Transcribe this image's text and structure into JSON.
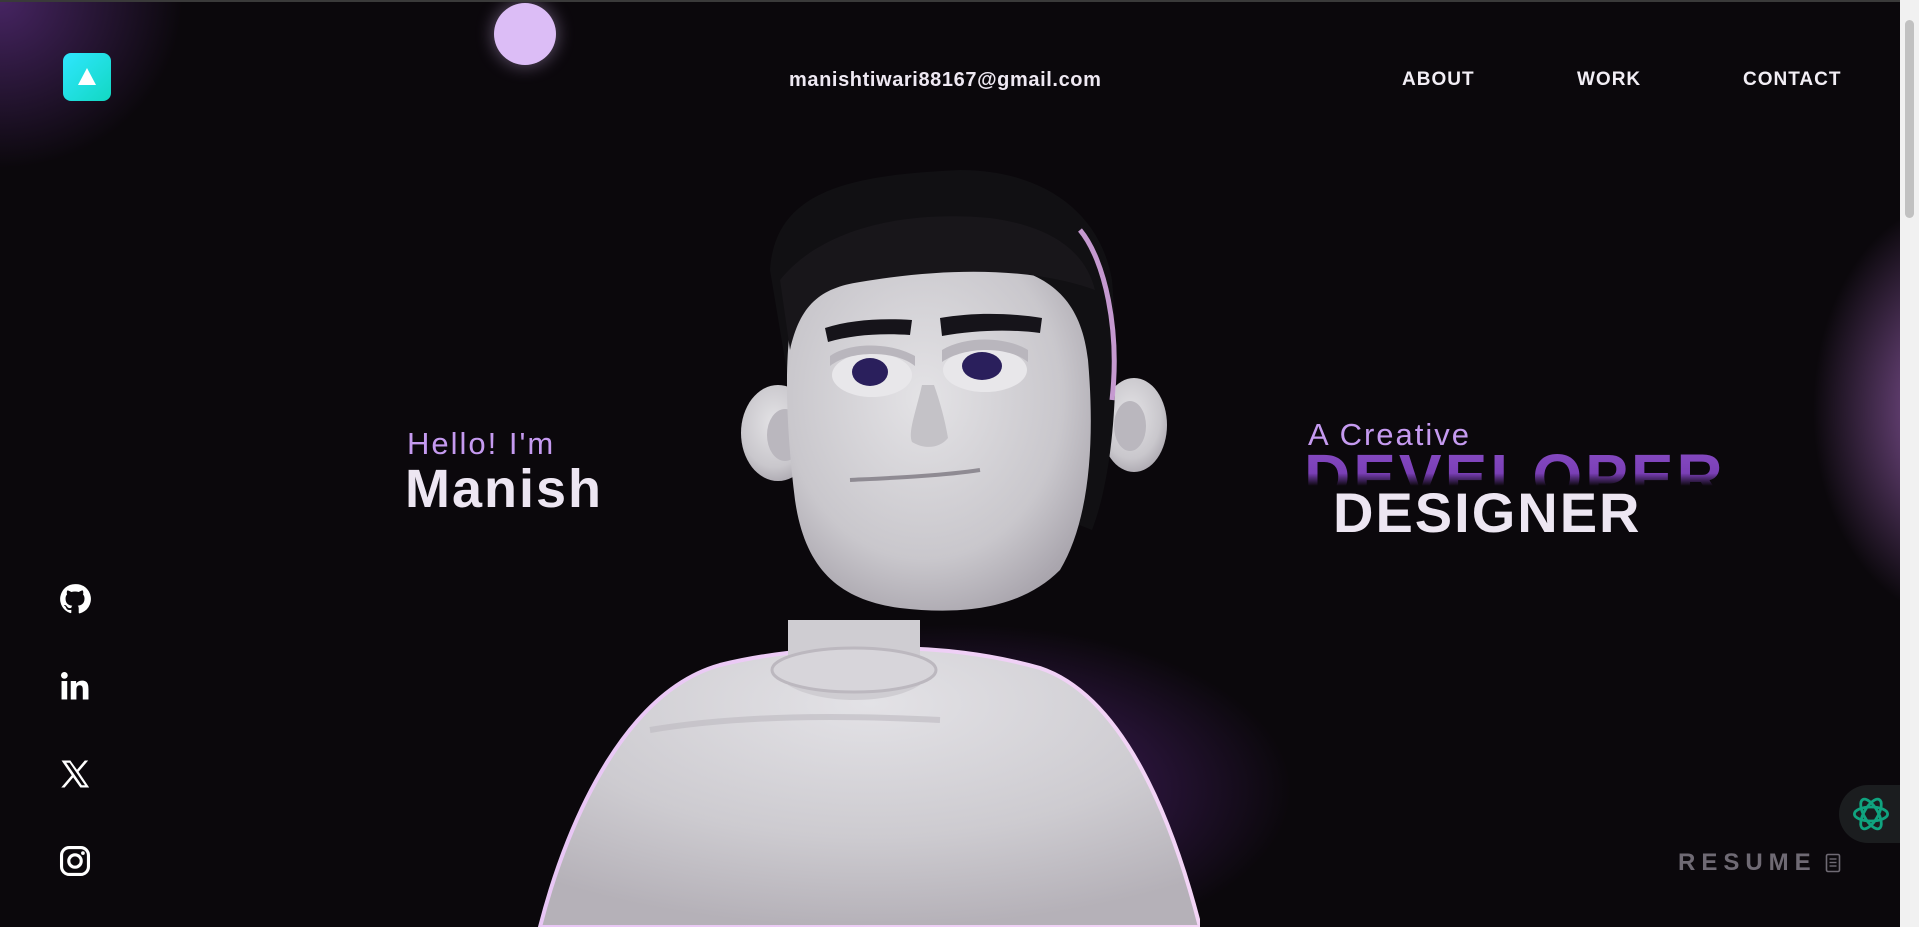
{
  "header": {
    "logo_icon": "triangle-logo-icon",
    "email": "manishtiwari88167@gmail.com",
    "nav": [
      {
        "label": "ABOUT"
      },
      {
        "label": "WORK"
      },
      {
        "label": "CONTACT"
      }
    ]
  },
  "hero": {
    "greeting": "Hello! I'm",
    "name": "Manish",
    "tagline": "A Creative",
    "role_back": "DEVELOPER",
    "role_front": "DESIGNER"
  },
  "social": [
    {
      "icon": "github-icon"
    },
    {
      "icon": "linkedin-icon"
    },
    {
      "icon": "x-icon"
    },
    {
      "icon": "instagram-icon"
    }
  ],
  "resume": {
    "label": "RESUME",
    "icon": "document-icon"
  },
  "colors": {
    "background": "#0b080c",
    "accent_purple": "#c59af0",
    "logo_cyan": "#2fe6ff",
    "moon": "#dcbdf6",
    "ai_badge_green": "#10a37f"
  }
}
